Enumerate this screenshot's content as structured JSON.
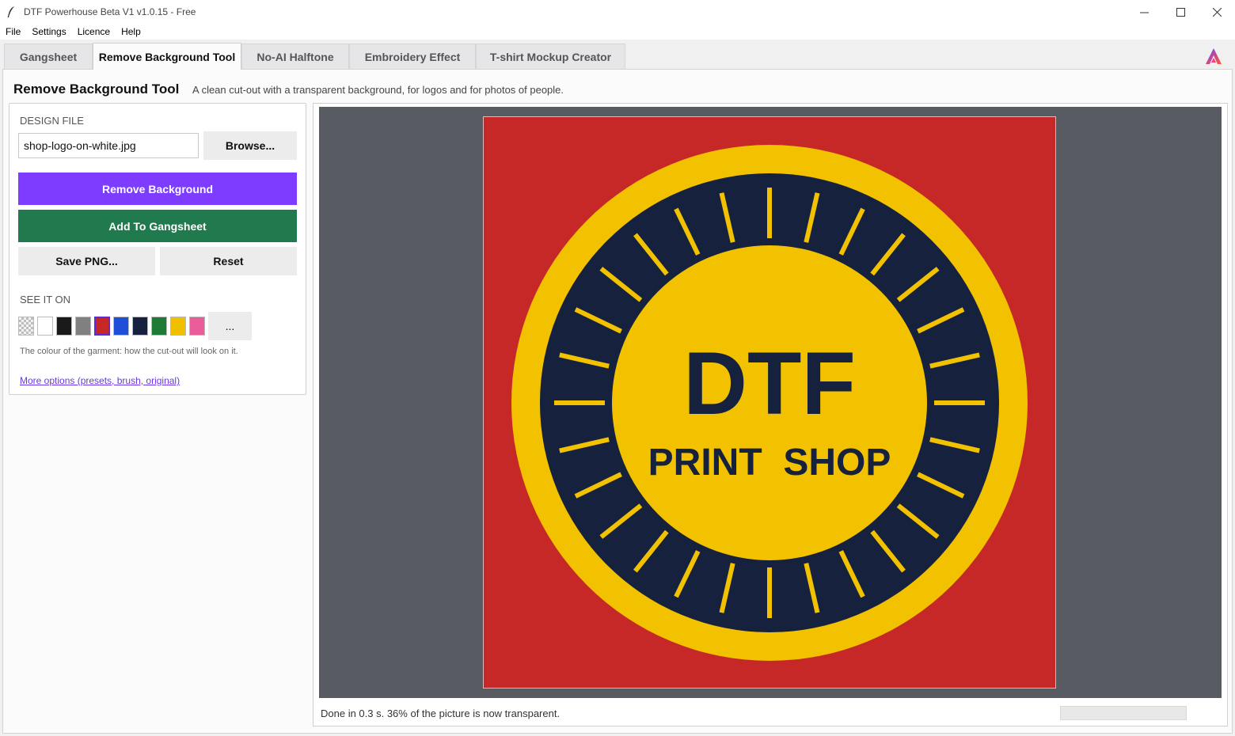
{
  "window": {
    "title": "DTF Powerhouse Beta V1  v1.0.15 - Free",
    "controls": [
      "minimize-icon",
      "maximize-icon",
      "close-icon"
    ]
  },
  "menu": [
    "File",
    "Settings",
    "Licence",
    "Help"
  ],
  "tabs": [
    {
      "label": "Gangsheet",
      "active": false
    },
    {
      "label": "Remove Background Tool",
      "active": true
    },
    {
      "label": "No-AI Halftone",
      "active": false
    },
    {
      "label": "Embroidery Effect",
      "active": false
    },
    {
      "label": "T-shirt Mockup Creator",
      "active": false
    }
  ],
  "page": {
    "title": "Remove Background Tool",
    "subtitle": "A clean cut-out with a transparent background, for logos and for photos of people."
  },
  "panel": {
    "design_file_label": "DESIGN FILE",
    "file_value": "shop-logo-on-white.jpg",
    "browse_label": "Browse...",
    "remove_bg_label": "Remove Background",
    "add_gangsheet_label": "Add To Gangsheet",
    "save_png_label": "Save PNG...",
    "reset_label": "Reset",
    "see_it_on_label": "SEE IT ON",
    "swatches": [
      {
        "name": "transparent",
        "color": "checker"
      },
      {
        "name": "white",
        "color": "#ffffff"
      },
      {
        "name": "black",
        "color": "#1a1a1a"
      },
      {
        "name": "grey",
        "color": "#808080"
      },
      {
        "name": "red",
        "color": "#c62828",
        "selected": true
      },
      {
        "name": "blue",
        "color": "#1f4fd8"
      },
      {
        "name": "navy",
        "color": "#16213d"
      },
      {
        "name": "green",
        "color": "#1e7a34"
      },
      {
        "name": "yellow",
        "color": "#f0c000"
      },
      {
        "name": "pink",
        "color": "#e85d9a"
      }
    ],
    "more_swatches_label": "...",
    "hint": "The colour of the garment: how the cut-out will look on it.",
    "more_options_link": "More options (presets, brush, original)"
  },
  "preview": {
    "background_color": "#c62828",
    "logo": {
      "line1": "DTF",
      "line2": "PRINT  SHOP",
      "ring_color": "#f2c100",
      "inner_color": "#16213d"
    }
  },
  "status": {
    "message": "Done in 0.3 s. 36% of the picture is now transparent.",
    "progress_fraction": 0
  },
  "colors": {
    "accent": "#7d3cff",
    "green": "#217a4e"
  }
}
